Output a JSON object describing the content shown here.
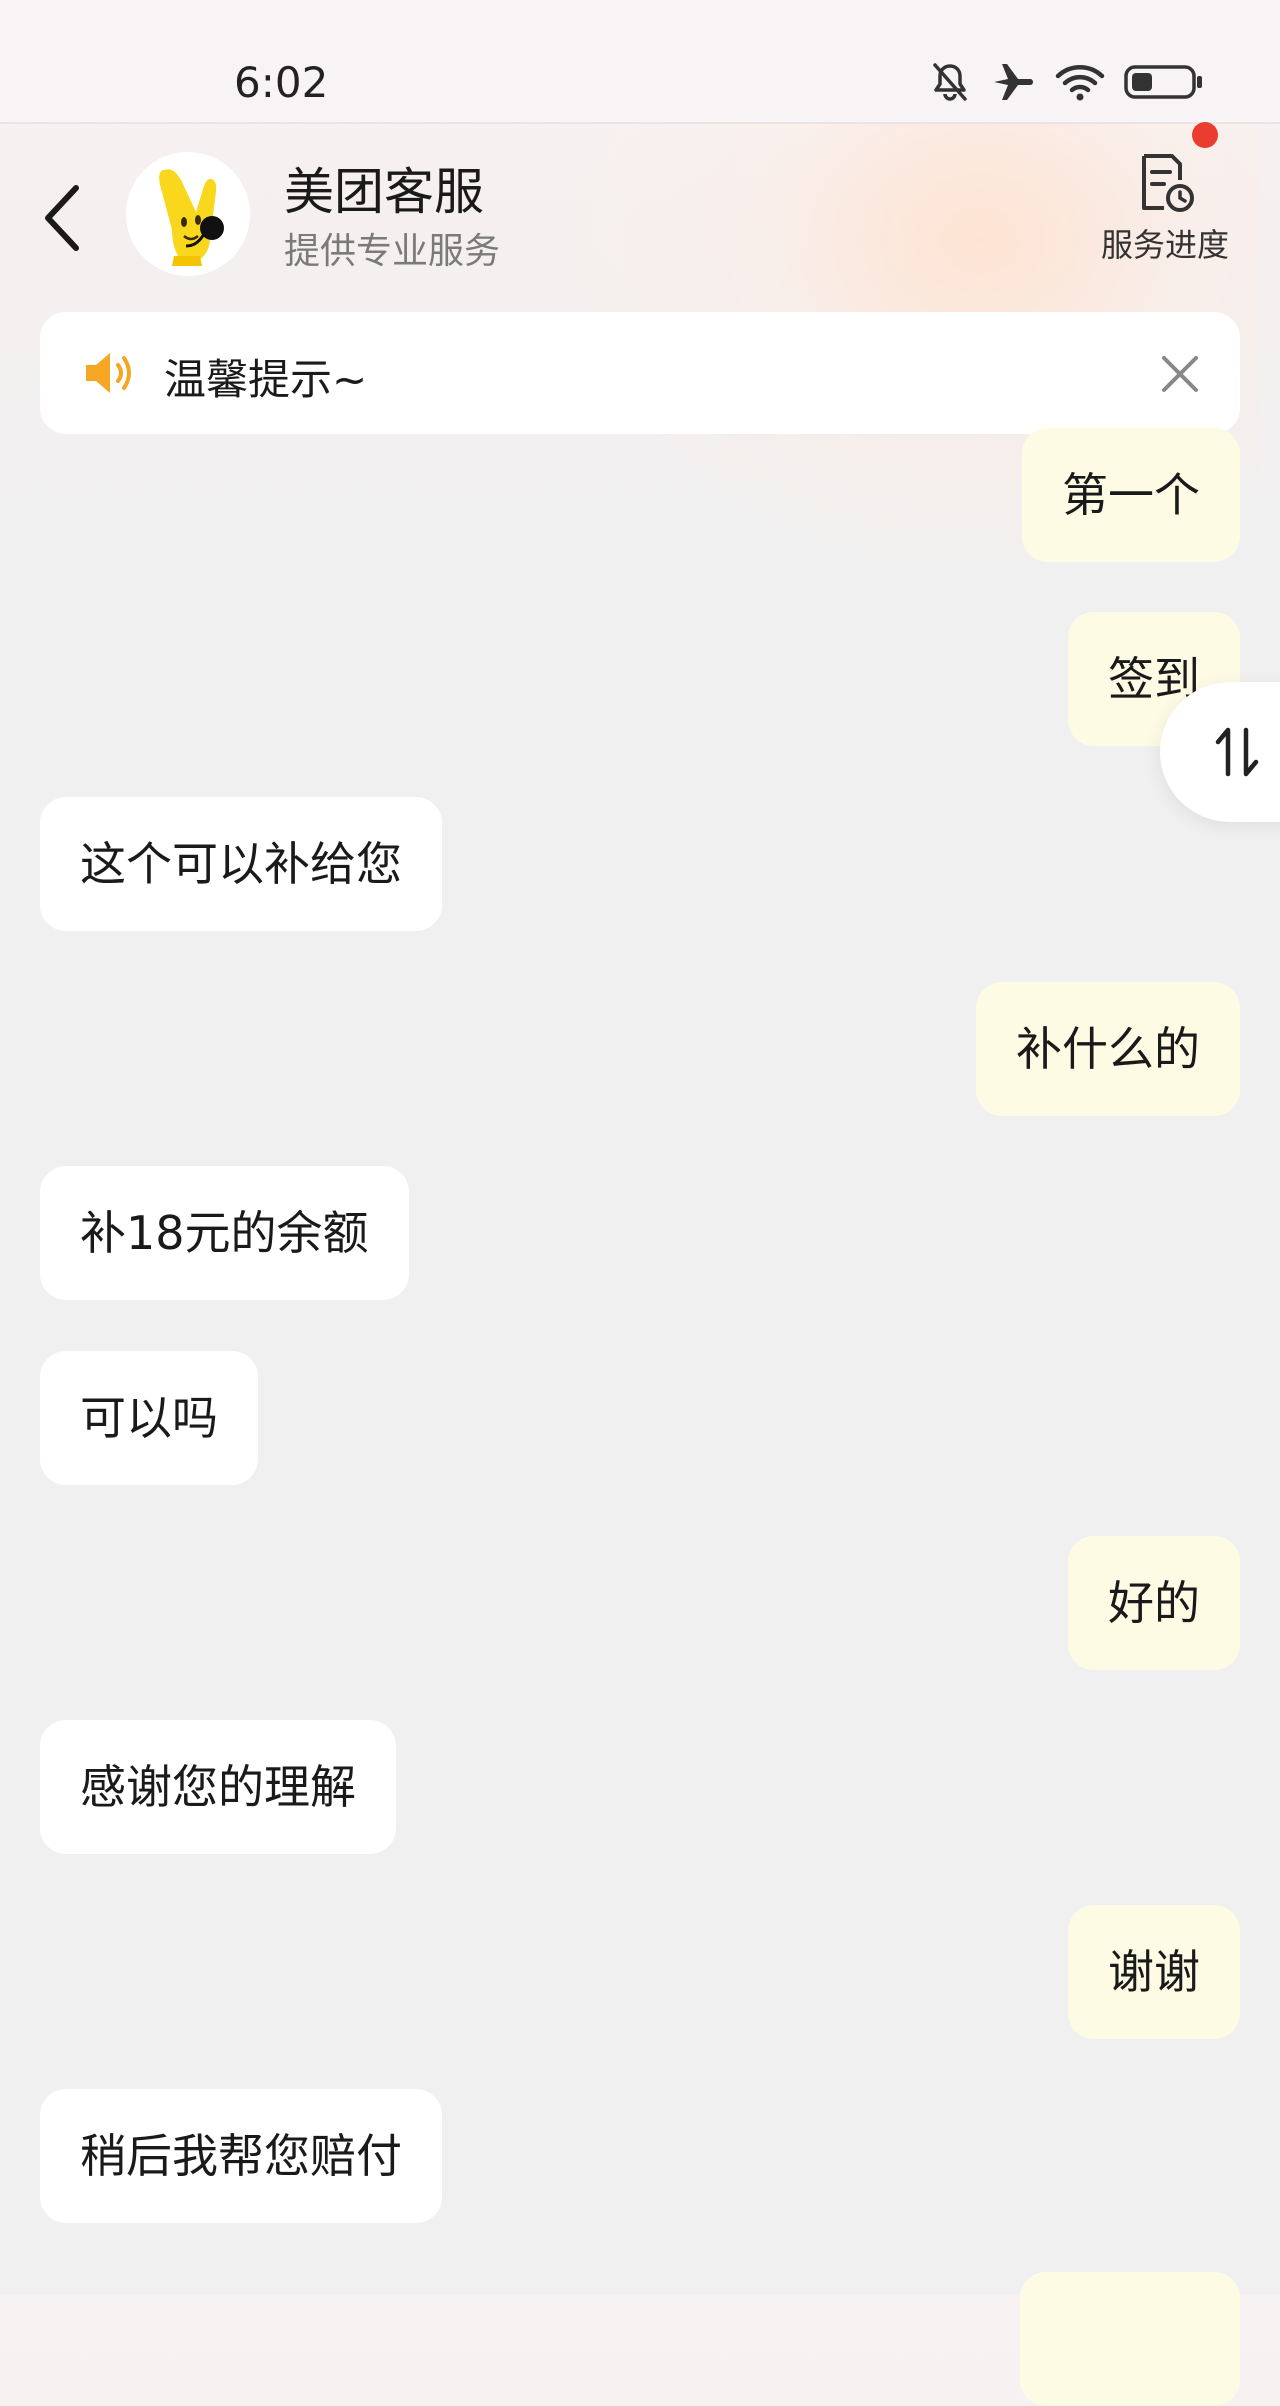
{
  "status_bar": {
    "time": "6:02",
    "icons": [
      "bell-off-icon",
      "airplane-icon",
      "wifi-icon",
      "battery-icon"
    ]
  },
  "header": {
    "back_icon": "chevron-left-icon",
    "title": "美团客服",
    "subtitle": "提供专业服务",
    "service_progress_label": "服务进度",
    "service_progress_icon": "document-clock-icon",
    "has_notification_dot": true
  },
  "notice": {
    "icon": "speaker-icon",
    "text": "温馨提示~",
    "close_icon": "close-icon"
  },
  "messages": [
    {
      "side": "out",
      "text": "第一个"
    },
    {
      "side": "out",
      "text": "签到"
    },
    {
      "side": "in",
      "text": "这个可以补给您"
    },
    {
      "side": "out",
      "text": "补什么的"
    },
    {
      "side": "in",
      "text": "补18元的余额"
    },
    {
      "side": "in",
      "text": "可以吗"
    },
    {
      "side": "out",
      "text": "好的"
    },
    {
      "side": "in",
      "text": "感谢您的理解"
    },
    {
      "side": "out",
      "text": "谢谢"
    },
    {
      "side": "in",
      "text": "稍后我帮您赔付"
    }
  ],
  "floating_button": {
    "icon": "swap-vertical-icon"
  },
  "colors": {
    "incoming_bubble": "#ffffff",
    "outgoing_bubble": "#fefbe4",
    "notice_icon": "#f5a623",
    "notification_dot": "#ea3c2f",
    "mascot_yellow": "#f9d71c"
  }
}
